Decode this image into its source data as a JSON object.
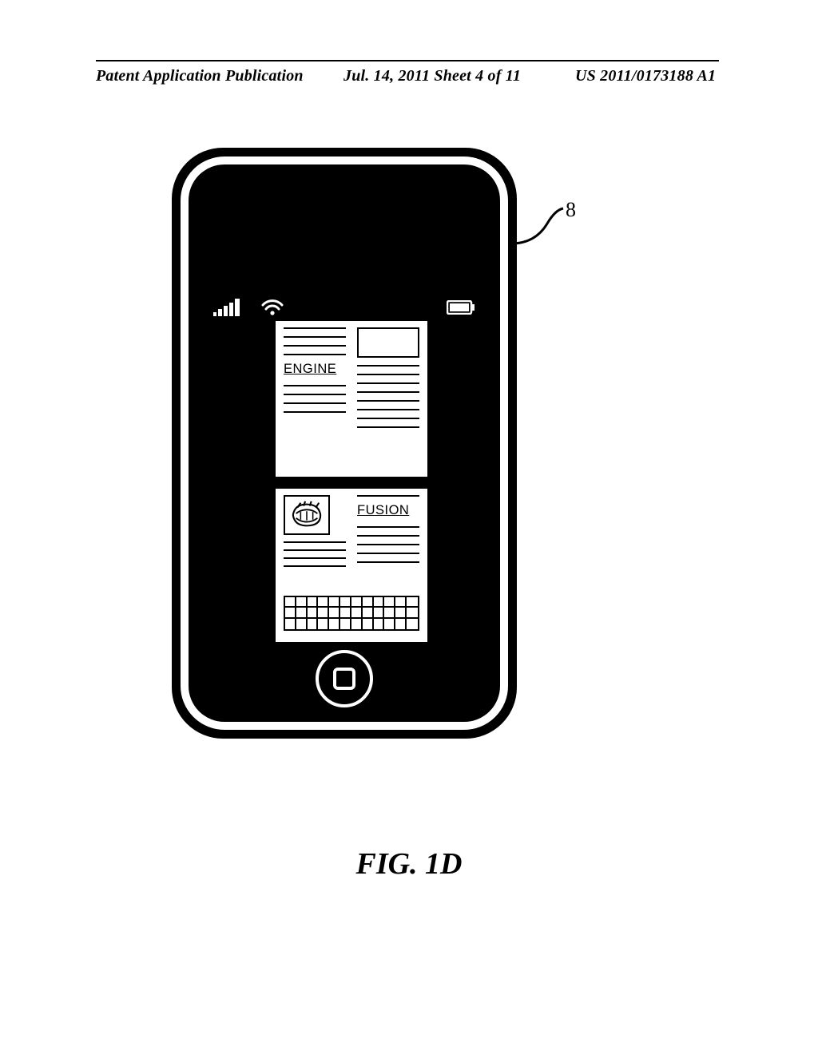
{
  "header": {
    "left": "Patent Application Publication",
    "center": "Jul. 14, 2011  Sheet 4 of 11",
    "right": "US 2011/0173188 A1"
  },
  "figure": {
    "label": "FIG. 1D",
    "lead_ref": "8"
  },
  "screen": {
    "card1": {
      "keyword": "ENGINE"
    },
    "card2": {
      "keyword": "FUSION"
    }
  }
}
